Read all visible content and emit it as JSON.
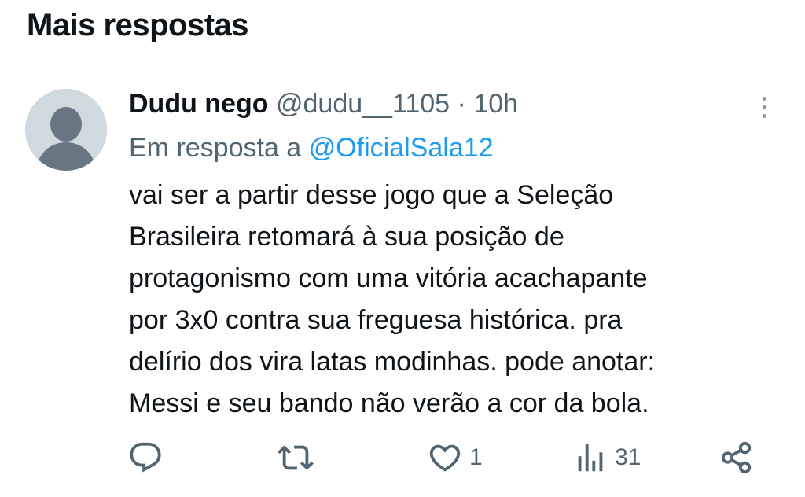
{
  "section": {
    "title": "Mais respostas"
  },
  "tweet": {
    "display_name": "Dudu nego",
    "handle": "@dudu__1105",
    "separator": "·",
    "time": "10h",
    "reply_prefix": "Em resposta a",
    "reply_to": "@OficialSala12",
    "text_lines": [
      "vai ser a partir desse jogo que a Seleção",
      "Brasileira retomará à sua posição de",
      "protagonismo com uma vitória acachapante",
      "por 3x0 contra sua freguesa histórica. pra",
      "delírio dos vira latas modinhas. pode anotar:",
      "Messi e seu bando não verão a cor da bola."
    ],
    "actions": {
      "reply": {
        "icon": "reply-icon",
        "count": ""
      },
      "retweet": {
        "icon": "retweet-icon",
        "count": ""
      },
      "like": {
        "icon": "heart-icon",
        "count": "1"
      },
      "views": {
        "icon": "views-icon",
        "count": "31"
      },
      "share": {
        "icon": "share-icon",
        "count": ""
      }
    }
  },
  "colors": {
    "text": "#0f1419",
    "secondary": "#536471",
    "link": "#1d9bf0",
    "avatar_bg": "#cfd9de",
    "avatar_fg": "#687684",
    "kebab": "#8b98a5"
  }
}
